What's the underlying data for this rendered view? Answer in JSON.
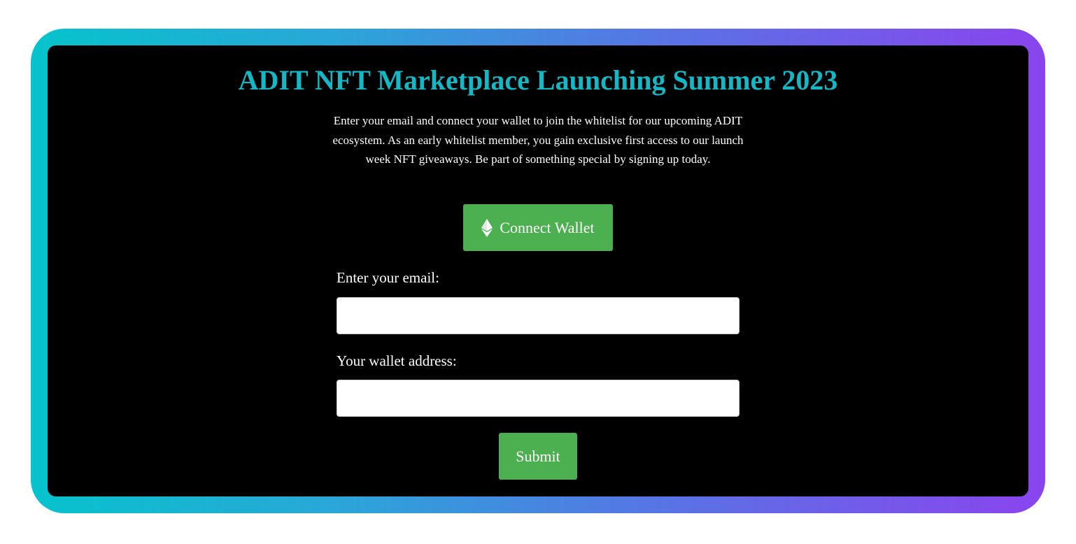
{
  "page": {
    "title": "ADIT NFT Marketplace Launching Summer 2023",
    "description": "Enter your email and connect your wallet to join the whitelist for our upcoming ADIT ecosystem. As an early whitelist member, you gain exclusive first access to our launch week NFT giveaways. Be part of something special by signing up today."
  },
  "wallet_button": {
    "label": "Connect Wallet",
    "icon": "ethereum-icon"
  },
  "form": {
    "email_label": "Enter your email:",
    "email_value": "",
    "email_placeholder": "",
    "wallet_label": "Your wallet address:",
    "wallet_value": "",
    "wallet_placeholder": "",
    "submit_label": "Submit"
  },
  "colors": {
    "title": "#12b8c6",
    "button": "#4caf50",
    "panel_background": "#000000",
    "gradient_start": "#06c3cc",
    "gradient_end": "#8a44ee"
  }
}
